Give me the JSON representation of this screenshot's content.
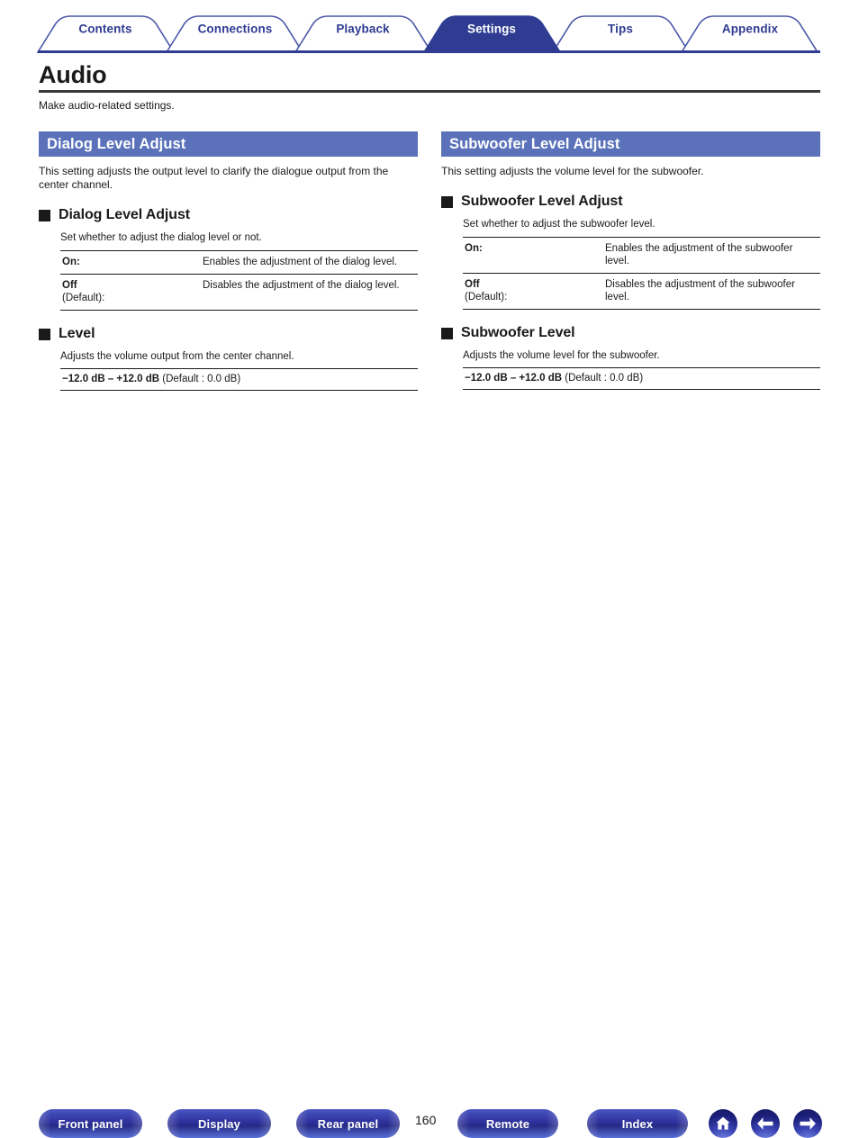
{
  "tabs": [
    {
      "label": "Contents",
      "active": false
    },
    {
      "label": "Connections",
      "active": false
    },
    {
      "label": "Playback",
      "active": false
    },
    {
      "label": "Settings",
      "active": true
    },
    {
      "label": "Tips",
      "active": false
    },
    {
      "label": "Appendix",
      "active": false
    }
  ],
  "page": {
    "title": "Audio",
    "subtitle": "Make audio-related settings.",
    "number": "160"
  },
  "left": {
    "header": "Dialog Level Adjust",
    "intro": "This setting adjusts the output level to clarify the dialogue output from the center channel.",
    "sub1": {
      "title": "Dialog Level Adjust",
      "desc": "Set whether to adjust the dialog level or not.",
      "rows": [
        {
          "key": "On:",
          "key_suffix": "",
          "value": "Enables the adjustment of the dialog level."
        },
        {
          "key": "Off",
          "key_suffix": "(Default):",
          "value": "Disables the adjustment of the dialog level."
        }
      ]
    },
    "sub2": {
      "title": "Level",
      "desc": "Adjusts the volume output from the center channel.",
      "range_bold": "−12.0 dB – +12.0 dB",
      "range_note": " (Default : 0.0 dB)"
    }
  },
  "right": {
    "header": "Subwoofer Level Adjust",
    "intro": "This setting adjusts the volume level for the subwoofer.",
    "sub1": {
      "title": "Subwoofer Level Adjust",
      "desc": "Set whether to adjust the subwoofer level.",
      "rows": [
        {
          "key": "On:",
          "key_suffix": "",
          "value": "Enables the adjustment of the subwoofer level."
        },
        {
          "key": "Off",
          "key_suffix": "(Default):",
          "value": "Disables the adjustment of the subwoofer level."
        }
      ]
    },
    "sub2": {
      "title": "Subwoofer Level",
      "desc": "Adjusts the volume level for the subwoofer.",
      "range_bold": "−12.0 dB – +12.0 dB",
      "range_note": " (Default : 0.0 dB)"
    }
  },
  "footer": {
    "buttons": [
      {
        "label": "Front panel"
      },
      {
        "label": "Display"
      },
      {
        "label": "Rear panel"
      },
      {
        "label": "Remote"
      },
      {
        "label": "Index"
      }
    ],
    "icons": [
      {
        "name": "home-icon"
      },
      {
        "name": "arrow-left-icon"
      },
      {
        "name": "arrow-right-icon"
      }
    ]
  },
  "colors": {
    "tab_active_bg": "#2f3c92",
    "tab_outline": "#4a57a8",
    "section_header_bg": "#5b72ba",
    "text": "#1a1a1a"
  }
}
